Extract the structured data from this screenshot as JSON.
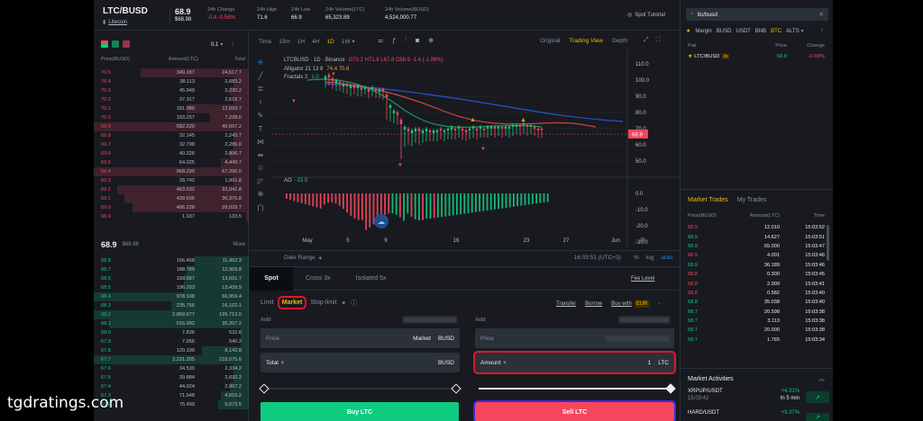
{
  "header": {
    "pair": "LTC/BUSD",
    "coin_name": "Litecoin",
    "price": "68.9",
    "price_usd": "$68.98",
    "stats": [
      {
        "label": "24h Change",
        "value": "-0.4 -0.58%",
        "tone": "r"
      },
      {
        "label": "24h High",
        "value": "71.6",
        "tone": "w"
      },
      {
        "label": "24h Low",
        "value": "66.9",
        "tone": "w"
      },
      {
        "label": "24h Volume(LTC)",
        "value": "65,323.89",
        "tone": "w"
      },
      {
        "label": "24h Volume(BUSD)",
        "value": "4,524,000.77",
        "tone": "w"
      }
    ],
    "spot_tutorial": "Spot Tutorial"
  },
  "orderbook": {
    "precision": "0.1",
    "columns": [
      "Price(BUSD)",
      "Amount(LTC)",
      "Total"
    ],
    "asks": [
      {
        "p": "70.5",
        "a": "349.187",
        "t": "24,617.7",
        "d": 0.7
      },
      {
        "p": "70.4",
        "a": "38.113",
        "t": "2,683.2",
        "d": 0.1
      },
      {
        "p": "70.3",
        "a": "45.949",
        "t": "3,230.2",
        "d": 0.12
      },
      {
        "p": "70.2",
        "a": "37.317",
        "t": "2,619.7",
        "d": 0.1
      },
      {
        "p": "70.1",
        "a": "181.080",
        "t": "12,693.7",
        "d": 0.4
      },
      {
        "p": "70.0",
        "a": "103.257",
        "t": "7,228.0",
        "d": 0.25
      },
      {
        "p": "69.9",
        "a": "582.220",
        "t": "40,697.2",
        "d": 1.0
      },
      {
        "p": "69.8",
        "a": "32.145",
        "t": "2,243.7",
        "d": 0.1
      },
      {
        "p": "69.7",
        "a": "32.798",
        "t": "2,286.0",
        "d": 0.1
      },
      {
        "p": "69.6",
        "a": "40.326",
        "t": "2,806.7",
        "d": 0.12
      },
      {
        "p": "69.5",
        "a": "64.025",
        "t": "4,449.7",
        "d": 0.18
      },
      {
        "p": "69.4",
        "a": "968.299",
        "t": "67,200.0",
        "d": 1.0
      },
      {
        "p": "69.3",
        "a": "28.742",
        "t": "1,991.8",
        "d": 0.1
      },
      {
        "p": "69.2",
        "a": "463.032",
        "t": "32,041.8",
        "d": 0.85
      },
      {
        "p": "69.1",
        "a": "439.606",
        "t": "30,376.8",
        "d": 0.8
      },
      {
        "p": "69.0",
        "a": "406.228",
        "t": "28,029.7",
        "d": 0.75
      },
      {
        "p": "68.9",
        "a": "1.937",
        "t": "133.5",
        "d": 0.02
      }
    ],
    "mid_price": "68.9",
    "mid_usd": "$68.98",
    "more": "More",
    "bids": [
      {
        "p": "68.8",
        "a": "166.458",
        "t": "11,452.3",
        "d": 0.35
      },
      {
        "p": "68.7",
        "a": "188.789",
        "t": "12,969.8",
        "d": 0.4
      },
      {
        "p": "68.6",
        "a": "199.587",
        "t": "13,691.7",
        "d": 0.42
      },
      {
        "p": "68.5",
        "a": "196.203",
        "t": "13,439.9",
        "d": 0.42
      },
      {
        "p": "68.4",
        "a": "978.938",
        "t": "66,959.4",
        "d": 1.0
      },
      {
        "p": "68.3",
        "a": "235.756",
        "t": "16,102.1",
        "d": 0.5
      },
      {
        "p": "68.2",
        "a": "2,869.677",
        "t": "195,712.0",
        "d": 1.0
      },
      {
        "p": "68.1",
        "a": "516.992",
        "t": "35,207.2",
        "d": 0.9
      },
      {
        "p": "68.0",
        "a": "7.836",
        "t": "532.8",
        "d": 0.05
      },
      {
        "p": "67.9",
        "a": "7.956",
        "t": "540.2",
        "d": 0.05
      },
      {
        "p": "67.8",
        "a": "120.100",
        "t": "8,142.8",
        "d": 0.3
      },
      {
        "p": "67.7",
        "a": "3,221.205",
        "t": "218,075.6",
        "d": 1.0
      },
      {
        "p": "67.6",
        "a": "34.530",
        "t": "2,334.2",
        "d": 0.1
      },
      {
        "p": "67.5",
        "a": "39.884",
        "t": "2,692.2",
        "d": 0.1
      },
      {
        "p": "67.4",
        "a": "44.024",
        "t": "2,967.2",
        "d": 0.12
      },
      {
        "p": "67.3",
        "a": "71.548",
        "t": "4,815.2",
        "d": 0.18
      },
      {
        "p": "67.2",
        "a": "75.499",
        "t": "5,073.5",
        "d": 0.2
      }
    ]
  },
  "chart_toolbar": {
    "time_label": "Time",
    "intervals": [
      "15m",
      "1H",
      "4H",
      "1D",
      "1W"
    ],
    "active_interval": "1D",
    "views": [
      "Original",
      "Trading View",
      "Depth"
    ],
    "active_view": "Trading View"
  },
  "chart_legend": {
    "symbol": "LTCBUSD · 1D · Binance",
    "ohlc": "O70.2 H71.6 L67.8 C68.9 -1.4 (-1.99%)",
    "alligator": "Alligator 21 13 8",
    "alligator_vals": "74.4 70.6",
    "fractals": "Fractals 2",
    "fractals_val": "1.0",
    "ao_label": "AO",
    "ao_val": "-15.5"
  },
  "chart_data": {
    "type": "candlestick",
    "price_axis": [
      "110.0",
      "100.0",
      "90.0",
      "80.0",
      "70.0",
      "60.0",
      "50.0"
    ],
    "ao_axis": [
      "0.0",
      "-10.0",
      "-20.0",
      "-30.0"
    ],
    "last_price_tag": "68.9",
    "x_labels": [
      "May",
      "5",
      "9",
      "16",
      "23",
      "27",
      "Jun"
    ]
  },
  "chart_footer": {
    "date_range": "Date Range",
    "clock": "16:03:51 (UTC+3)",
    "pct": "%",
    "log": "log",
    "auto": "auto"
  },
  "trade": {
    "tabs": [
      "Spot",
      "Cross 3x",
      "Isolated 5x"
    ],
    "fee_level": "Fee Level",
    "order_types": [
      "Limit",
      "Market",
      "Stop-limit"
    ],
    "links": [
      "Transfer",
      "Borrow",
      "Buy with"
    ],
    "buy_with_badge": "EUR",
    "avbl": "Avbl",
    "buy": {
      "price_label": "Price",
      "price_value": "Market",
      "price_unit": "BUSD",
      "total_label": "Total",
      "total_unit": "BUSD",
      "button": "Buy LTC"
    },
    "sell": {
      "price_label": "Price",
      "amount_label": "Amount",
      "amount_value": "1",
      "amount_unit": "LTC",
      "button": "Sell LTC"
    }
  },
  "right_panel": {
    "search_value": "ltc/busd",
    "markets": [
      "Margin",
      "BUSD",
      "USDT",
      "BNB",
      "BTC",
      "ALTS"
    ],
    "active_market": "BTC",
    "list_headers": [
      "Pair",
      "Price",
      "Change"
    ],
    "list_rows": [
      {
        "pair": "LTC/BUSD",
        "lev": "3x",
        "price": "68.9",
        "change": "-0.58%"
      }
    ],
    "trade_tabs": [
      "Market Trades",
      "My Trades"
    ],
    "trade_headers": [
      "Price(BUSD)",
      "Amount(LTC)",
      "Time"
    ],
    "trades": [
      {
        "p": "68.9",
        "a": "12.010",
        "t": "15:03:52",
        "s": "r"
      },
      {
        "p": "68.9",
        "a": "14.627",
        "t": "15:03:51",
        "s": "g"
      },
      {
        "p": "68.9",
        "a": "65.000",
        "t": "15:03:47",
        "s": "g"
      },
      {
        "p": "68.9",
        "a": "4.001",
        "t": "15:03:46",
        "s": "r"
      },
      {
        "p": "68.9",
        "a": "36.189",
        "t": "15:03:46",
        "s": "g"
      },
      {
        "p": "68.8",
        "a": "0.300",
        "t": "15:03:45",
        "s": "r"
      },
      {
        "p": "68.8",
        "a": "2.909",
        "t": "15:03:41",
        "s": "r"
      },
      {
        "p": "68.8",
        "a": "0.582",
        "t": "15:03:40",
        "s": "r"
      },
      {
        "p": "68.8",
        "a": "35.038",
        "t": "15:03:40",
        "s": "g"
      },
      {
        "p": "68.7",
        "a": "20.598",
        "t": "15:03:38",
        "s": "g"
      },
      {
        "p": "68.7",
        "a": "3.113",
        "t": "15:03:38",
        "s": "g"
      },
      {
        "p": "68.7",
        "a": "20.000",
        "t": "15:03:38",
        "s": "g"
      },
      {
        "p": "68.7",
        "a": "1.765",
        "t": "15:03:34",
        "s": "g"
      }
    ],
    "activities_title": "Market Activities",
    "activities": [
      {
        "pair": "XRPUP/USDT",
        "time": "15:03:42",
        "change": "+4.31%",
        "note": "In 5 min"
      },
      {
        "pair": "HARD/USDT",
        "time": "",
        "change": "+3.37%",
        "note": ""
      }
    ]
  },
  "watermark": "tgdratings.com"
}
